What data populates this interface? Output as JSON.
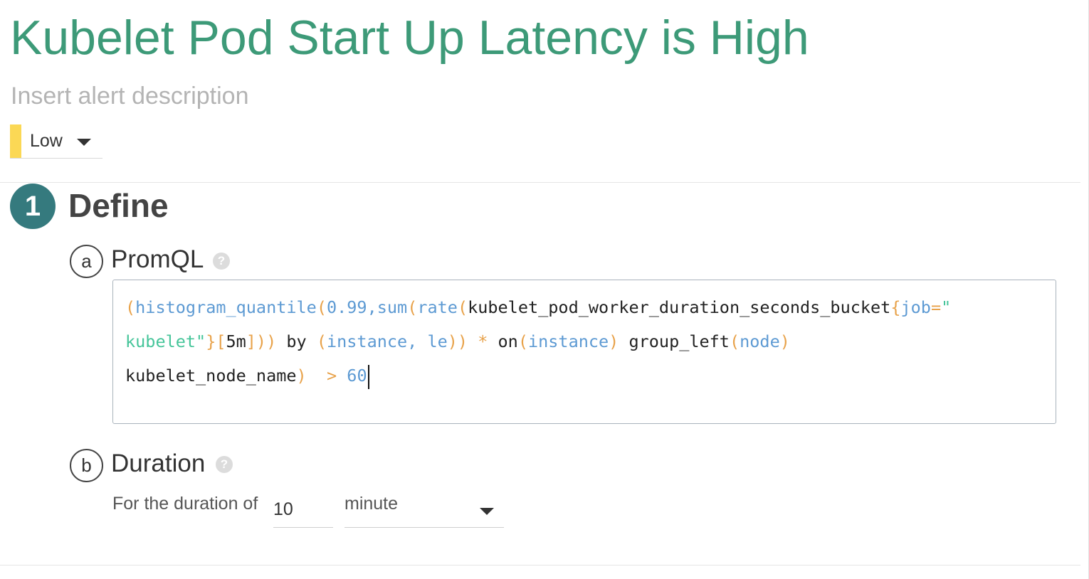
{
  "alert": {
    "title": "Kubelet Pod Start Up Latency is High",
    "description_placeholder": "Insert alert description",
    "severity": {
      "label": "Low",
      "color": "#fbd855"
    }
  },
  "define": {
    "step_number": "1",
    "title": "Define",
    "promql": {
      "letter": "a",
      "title": "PromQL",
      "help": "?",
      "lines": [
        [
          {
            "t": "(",
            "c": "p"
          },
          {
            "t": "histogram_quantile",
            "c": "fn"
          },
          {
            "t": "(",
            "c": "p"
          },
          {
            "t": "0.99",
            "c": "num"
          },
          {
            "t": ",",
            "c": "fn"
          },
          {
            "t": "sum",
            "c": "fn"
          },
          {
            "t": "(",
            "c": "p"
          },
          {
            "t": "rate",
            "c": "fn"
          },
          {
            "t": "(",
            "c": "p"
          },
          {
            "t": "kubelet_pod_worker_duration_seconds_bucket",
            "c": ""
          },
          {
            "t": "{",
            "c": "p"
          },
          {
            "t": "job",
            "c": "fn"
          },
          {
            "t": "=",
            "c": "p"
          },
          {
            "t": "\"",
            "c": "str"
          }
        ],
        [
          {
            "t": "kubelet\"",
            "c": "str"
          },
          {
            "t": "}[",
            "c": "p"
          },
          {
            "t": "5m",
            "c": ""
          },
          {
            "t": "]))",
            "c": "p"
          },
          {
            "t": " by ",
            "c": ""
          },
          {
            "t": "(",
            "c": "p"
          },
          {
            "t": "instance, le",
            "c": "fn"
          },
          {
            "t": "))",
            "c": "p"
          },
          {
            "t": " ",
            "c": ""
          },
          {
            "t": "*",
            "c": "p"
          },
          {
            "t": " on",
            "c": ""
          },
          {
            "t": "(",
            "c": "p"
          },
          {
            "t": "instance",
            "c": "fn"
          },
          {
            "t": ")",
            "c": "p"
          },
          {
            "t": " group_left",
            "c": ""
          },
          {
            "t": "(",
            "c": "p"
          },
          {
            "t": "node",
            "c": "fn"
          },
          {
            "t": ")",
            "c": "p"
          }
        ],
        [
          {
            "t": "kubelet_node_name",
            "c": ""
          },
          {
            "t": ")",
            "c": "p"
          },
          {
            "t": "  ",
            "c": ""
          },
          {
            "t": ">",
            "c": "p"
          },
          {
            "t": " ",
            "c": ""
          },
          {
            "t": "60",
            "c": "num"
          }
        ]
      ]
    },
    "duration": {
      "letter": "b",
      "title": "Duration",
      "help": "?",
      "label": "For the duration of",
      "value": "10",
      "unit": "minute"
    }
  }
}
